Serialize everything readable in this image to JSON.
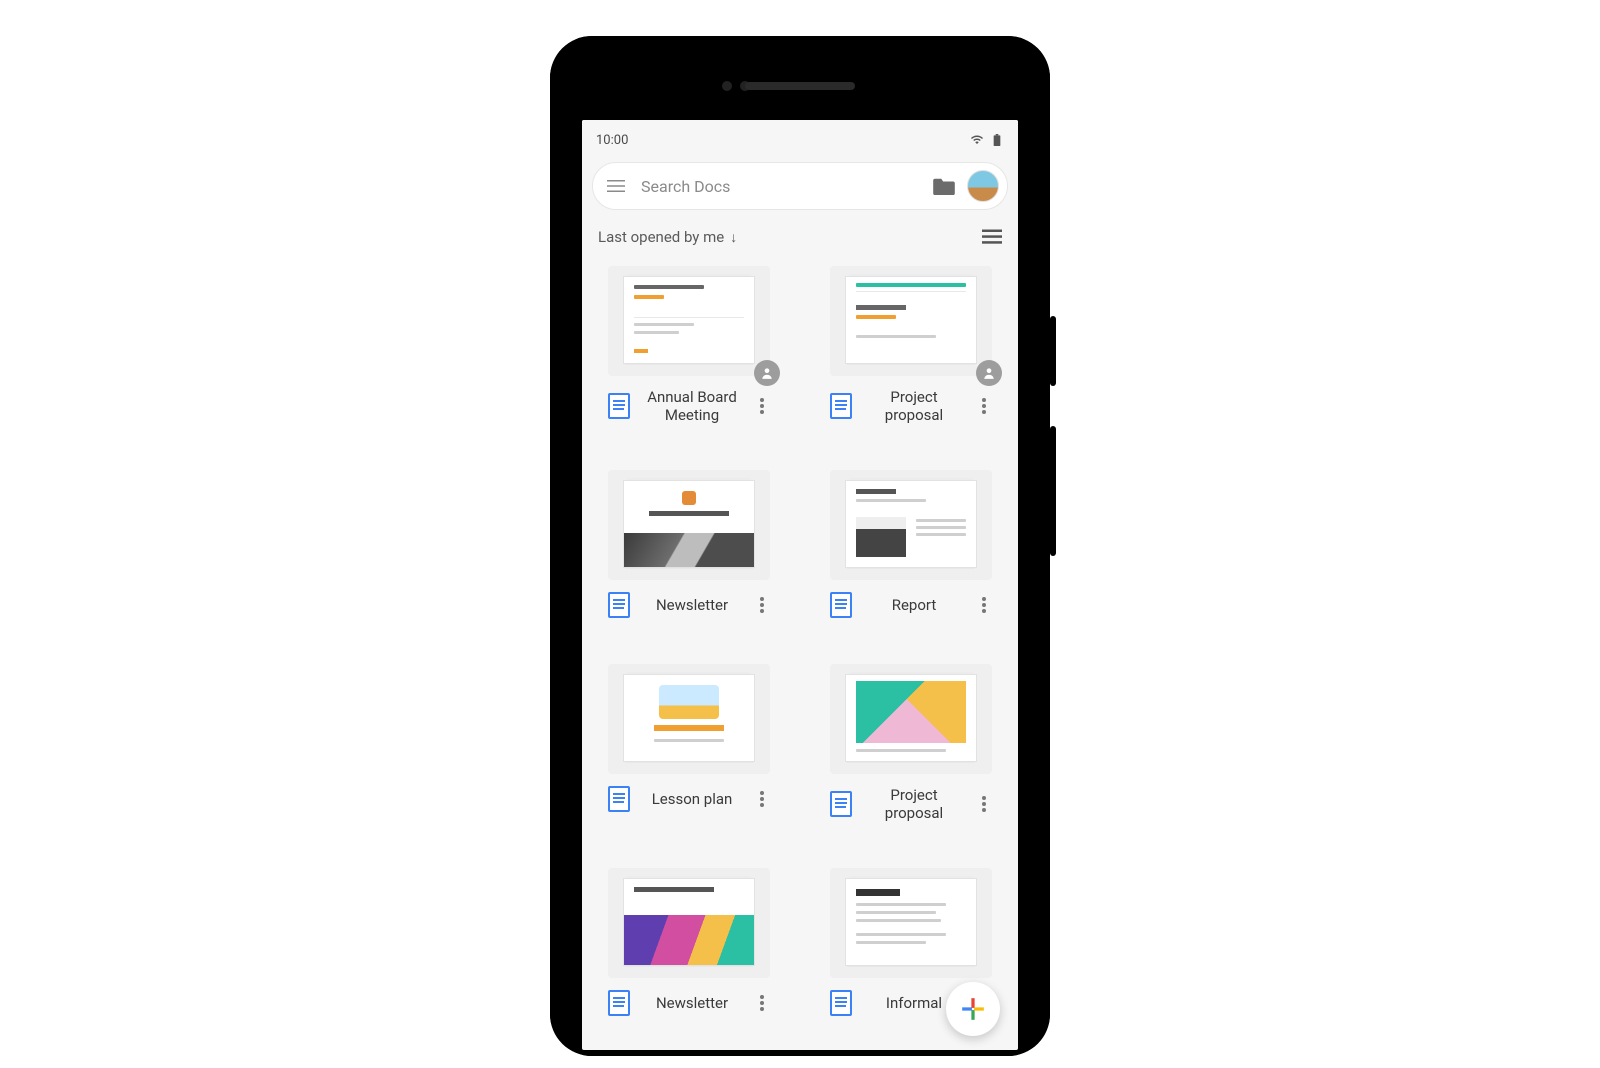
{
  "status_bar": {
    "time": "10:00"
  },
  "search": {
    "placeholder": "Search Docs"
  },
  "sort": {
    "label": "Last opened by me",
    "direction_icon": "↓"
  },
  "documents": [
    {
      "title": "Annual Board Meeting",
      "shared": true
    },
    {
      "title": "Project proposal",
      "shared": true
    },
    {
      "title": "Newsletter",
      "shared": false
    },
    {
      "title": "Report",
      "shared": false
    },
    {
      "title": "Lesson plan",
      "shared": false
    },
    {
      "title": "Project proposal",
      "shared": false
    },
    {
      "title": "Newsletter",
      "shared": false
    },
    {
      "title": "Informal",
      "shared": false
    }
  ]
}
